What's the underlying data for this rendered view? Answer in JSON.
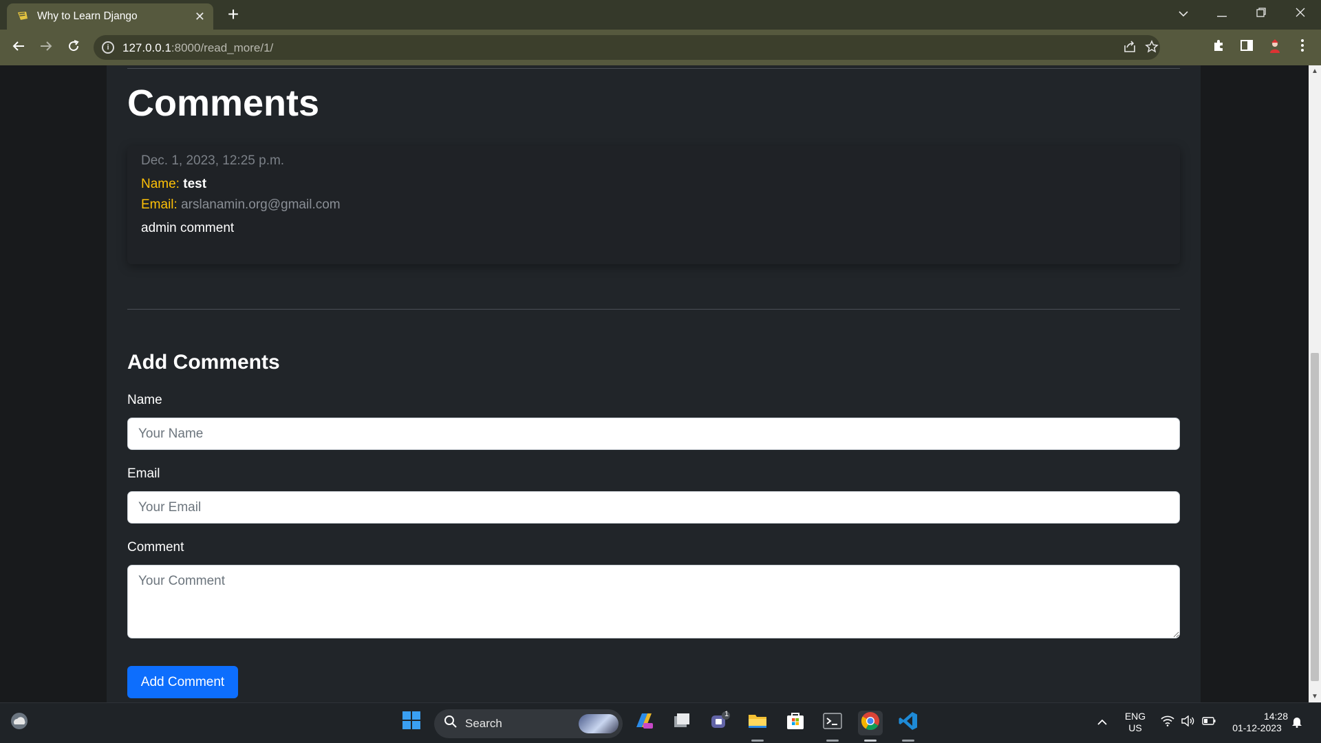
{
  "browser": {
    "tab_title": "Why to Learn Django",
    "tab_close": "✕",
    "new_tab": "+",
    "url_host": "127.0.0.1",
    "url_path": ":8000/read_more/1/"
  },
  "comments_section": {
    "heading": "Comments",
    "items": [
      {
        "date": "Dec. 1, 2023, 12:25 p.m.",
        "name_label": "Name:",
        "name": "test",
        "email_label": "Email:",
        "email": "arslanamin.org@gmail.com",
        "text": "admin comment"
      }
    ]
  },
  "add_form": {
    "heading": "Add Comments",
    "name_label": "Name",
    "name_placeholder": "Your Name",
    "email_label": "Email",
    "email_placeholder": "Your Email",
    "comment_label": "Comment",
    "comment_placeholder": "Your Comment",
    "submit_label": "Add Comment"
  },
  "taskbar": {
    "search_label": "Search",
    "teams_badge": "1",
    "language_line1": "ENG",
    "language_line2": "US",
    "time": "14:28",
    "date": "01-12-2023"
  },
  "colors": {
    "page_bg": "#212529",
    "accent_label": "#ffc107",
    "button_primary": "#0d6efd",
    "browser_toolbar": "#56593e"
  }
}
